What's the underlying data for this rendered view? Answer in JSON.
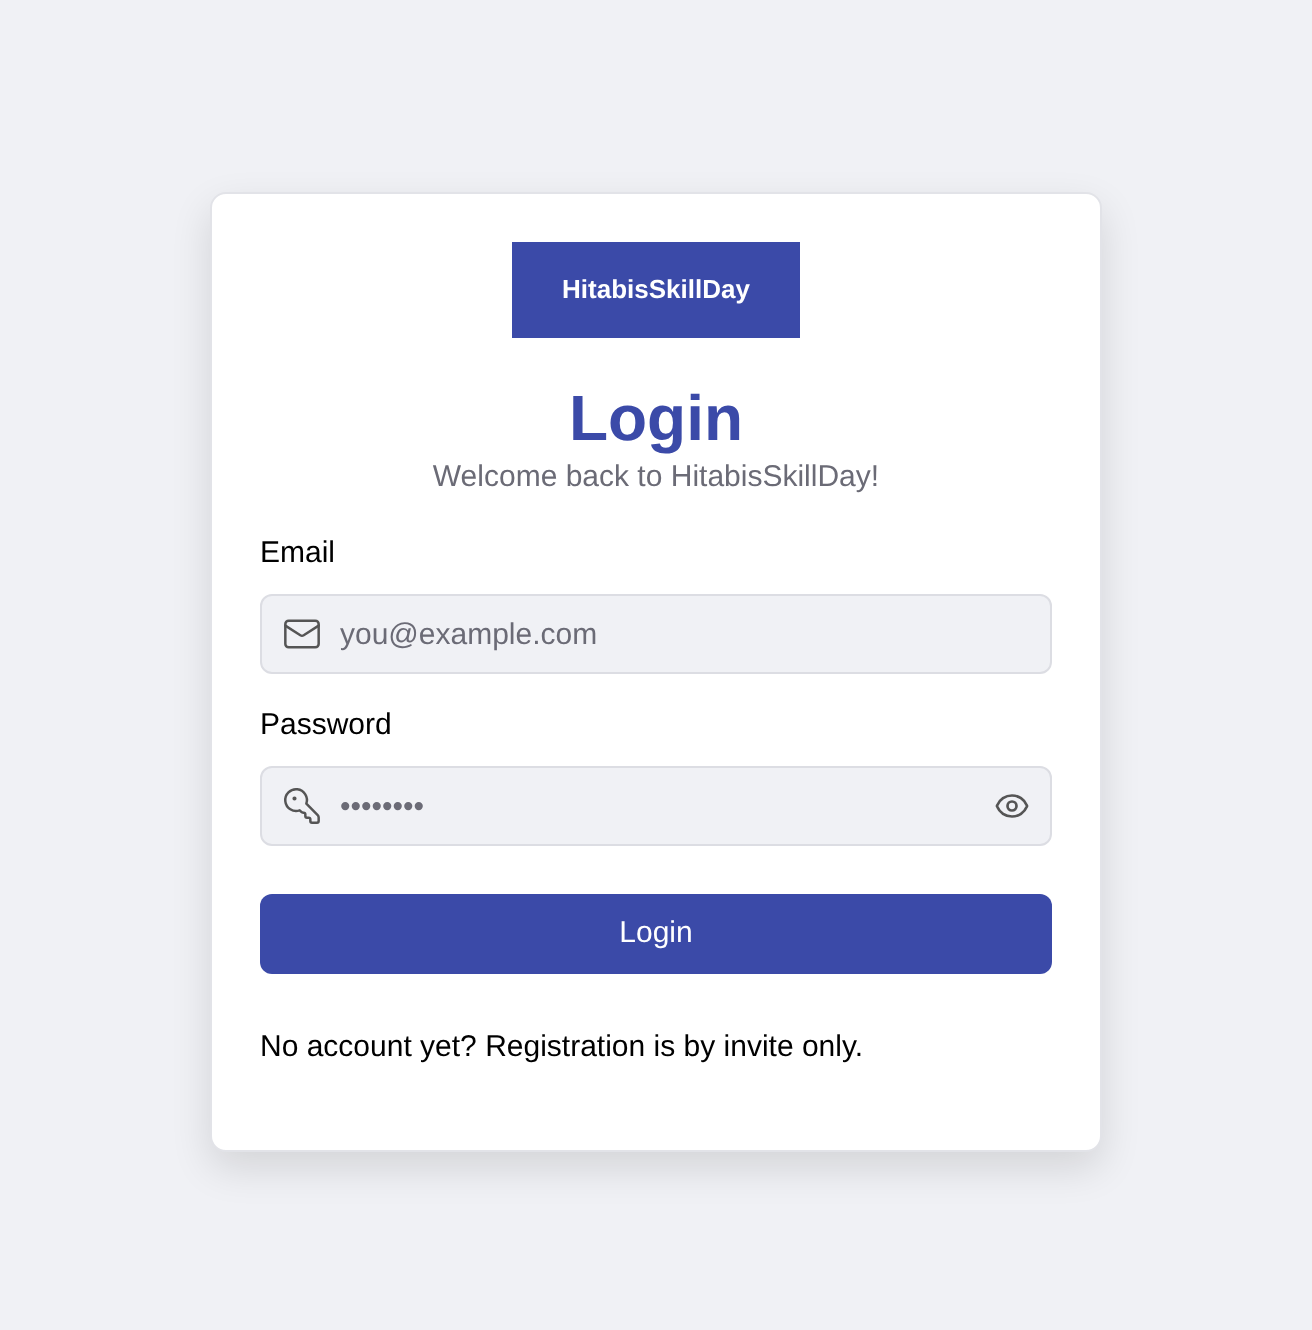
{
  "logo": {
    "text": "HitabisSkillDay"
  },
  "title": "Login",
  "subtitle": "Welcome back to HitabisSkillDay!",
  "fields": [
    {
      "kind": "email",
      "label": "Email",
      "placeholder": "you@example.com"
    },
    {
      "kind": "password",
      "label": "Password",
      "placeholder": "••••••••"
    }
  ],
  "button": "Login",
  "footer": "No account yet? Registration is by invite only."
}
